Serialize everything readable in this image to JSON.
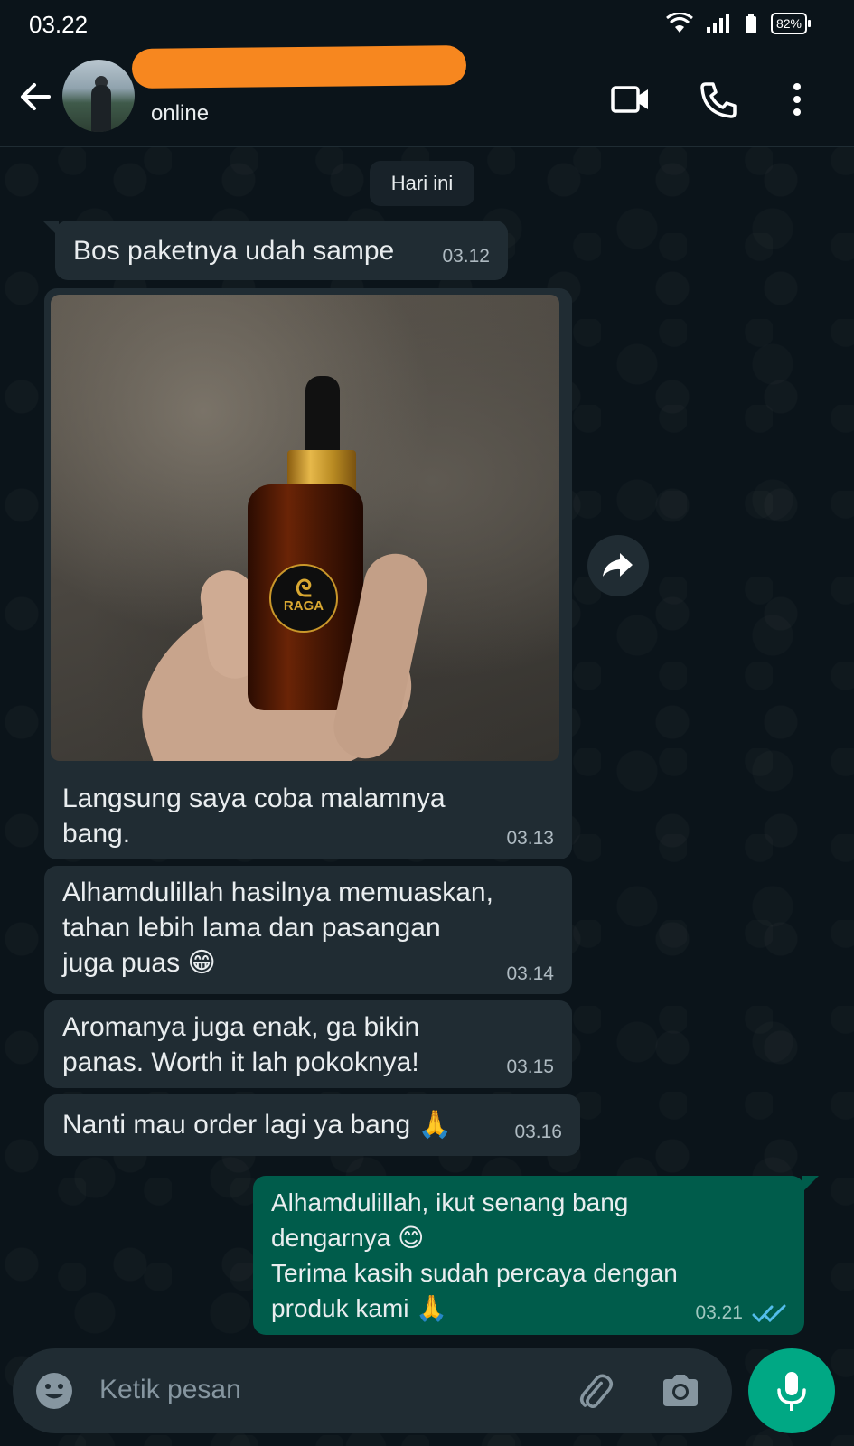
{
  "status_bar": {
    "time": "03.22",
    "battery": "82%"
  },
  "header": {
    "status": "online",
    "icons": [
      "back-arrow-icon",
      "video-call-icon",
      "phone-call-icon",
      "more-options-icon"
    ]
  },
  "chat": {
    "date_chip": "Hari ini",
    "messages": [
      {
        "direction": "in",
        "text": "Bos paketnya udah sampe",
        "time": "03.12"
      },
      {
        "direction": "in",
        "type": "image",
        "text": "Langsung saya coba malamnya\nbang.",
        "time": "03.13",
        "image_label": "RAGA"
      },
      {
        "direction": "in",
        "text": "Alhamdulillah hasilnya memuaskan,\ntahan lebih lama dan pasangan\njuga puas 😁",
        "time": "03.14"
      },
      {
        "direction": "in",
        "text": "Aromanya juga enak, ga bikin\npanas. Worth it lah pokoknya!",
        "time": "03.15"
      },
      {
        "direction": "in",
        "text": "Nanti mau order lagi ya bang 🙏",
        "time": "03.16"
      },
      {
        "direction": "out",
        "text": "Alhamdulillah, ikut senang bang\ndengarnya 😊\nTerima kasih sudah percaya dengan\nproduk kami 🙏",
        "time": "03.21",
        "read_receipt": "double-check-icon"
      }
    ]
  },
  "composer": {
    "placeholder": "Ketik pesan"
  },
  "colors": {
    "background": "#0b141a",
    "incoming_bubble": "#202c33",
    "outgoing_bubble": "#005c4b",
    "accent": "#00a884",
    "read_tick": "#53bdeb"
  }
}
